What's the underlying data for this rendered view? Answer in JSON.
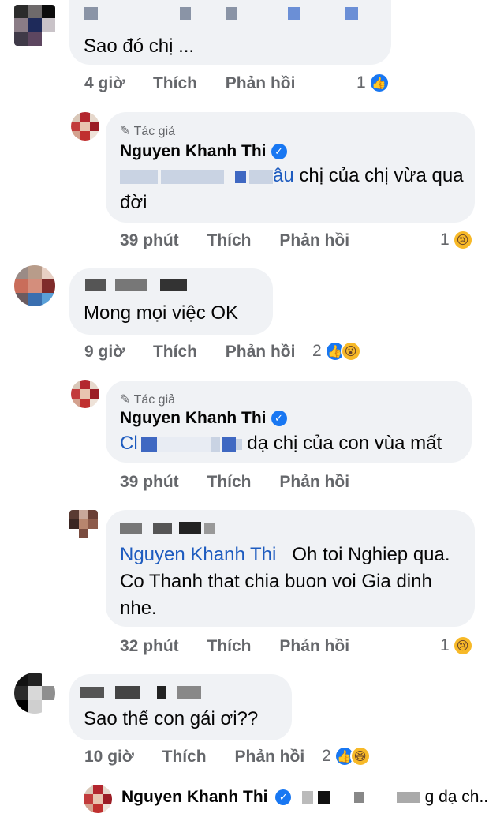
{
  "comments": [
    {
      "id": "c1",
      "text": "Sao đó chị ...",
      "time": "4 giờ",
      "like_label": "Thích",
      "reply_label": "Phản hồi",
      "reaction_count": "1",
      "reactions": [
        "like-icon"
      ]
    },
    {
      "id": "c1r1",
      "author_tag": "Tác giả",
      "author": "Nguyen Khanh Thi",
      "mention_fragment": "âu",
      "text": "chị của chị vừa qua đời",
      "time": "39 phút",
      "like_label": "Thích",
      "reply_label": "Phản hồi",
      "reaction_count": "1",
      "reactions": [
        "sad-icon"
      ]
    },
    {
      "id": "c2",
      "text": "Mong mọi việc OK",
      "time": "9 giờ",
      "like_label": "Thích",
      "reply_label": "Phản hồi",
      "reaction_count": "2",
      "reactions": [
        "like-icon",
        "wow-icon"
      ]
    },
    {
      "id": "c2r1",
      "author_tag": "Tác giả",
      "author": "Nguyen Khanh Thi",
      "mention_fragment": "Cl",
      "text": "dạ chị của con vùa mất",
      "time": "39 phút",
      "like_label": "Thích",
      "reply_label": "Phản hồi"
    },
    {
      "id": "c2r2",
      "mention": "Nguyen Khanh Thi",
      "text": "Oh toi Nghiep qua. Co Thanh that chia buon voi Gia dinh nhe.",
      "time": "32 phút",
      "like_label": "Thích",
      "reply_label": "Phản hồi",
      "reaction_count": "1",
      "reactions": [
        "sad-icon"
      ]
    },
    {
      "id": "c3",
      "text": "Sao thế con gái ơi??",
      "time": "10 giờ",
      "like_label": "Thích",
      "reply_label": "Phản hồi",
      "reaction_count": "2",
      "reactions": [
        "like-icon",
        "haha-icon"
      ]
    },
    {
      "id": "c3r1",
      "author": "Nguyen Khanh Thi",
      "text_fragment": "g dạ ch..."
    }
  ],
  "colors": {
    "bubble": "#f0f2f5",
    "meta": "#65676b",
    "mention": "#1d5bbf",
    "like": "#1877f2",
    "emoji": "#f7b928"
  }
}
